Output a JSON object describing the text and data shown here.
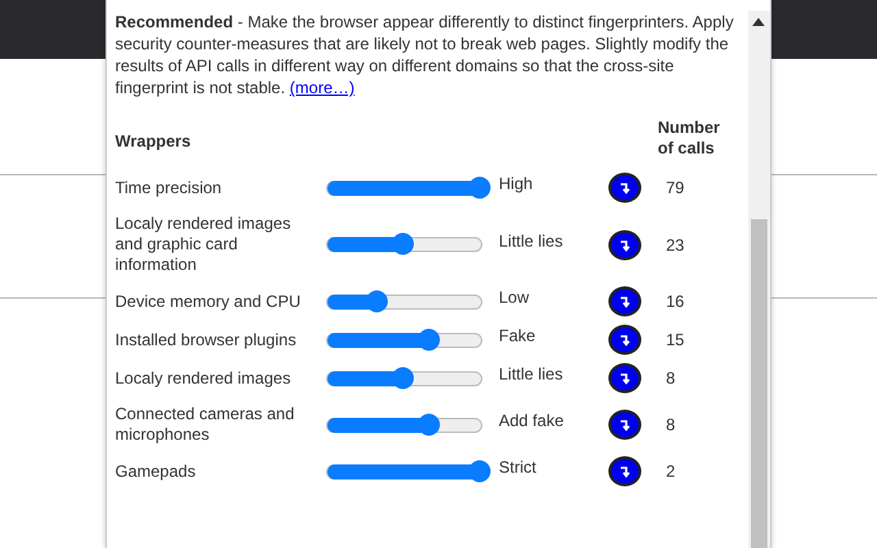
{
  "description": {
    "lead": "Recommended",
    "text": " - Make the browser appear differently to distinct fingerprinters. Apply security counter-measures that are likely not to break web pages. Slightly modify the results of API calls in different way on different domains so that the cross-site fingerprint is not stable. ",
    "link": "(more…)"
  },
  "headers": {
    "wrappers": "Wrappers",
    "calls": "Number of calls"
  },
  "rows": [
    {
      "name": "Time precision",
      "level": 1.0,
      "setting": "High",
      "count": "79"
    },
    {
      "name": "Localy rendered images and graphic card information",
      "level": 0.5,
      "setting": "Little lies",
      "count": "23"
    },
    {
      "name": "Device memory and CPU",
      "level": 0.33,
      "setting": "Low",
      "count": "16"
    },
    {
      "name": "Installed browser plugins",
      "level": 0.67,
      "setting": "Fake",
      "count": "15"
    },
    {
      "name": "Localy rendered images",
      "level": 0.5,
      "setting": "Little lies",
      "count": "8"
    },
    {
      "name": "Connected cameras and microphones",
      "level": 0.67,
      "setting": "Add fake",
      "count": "8"
    },
    {
      "name": "Gamepads",
      "level": 1.0,
      "setting": "Strict",
      "count": "2"
    }
  ]
}
